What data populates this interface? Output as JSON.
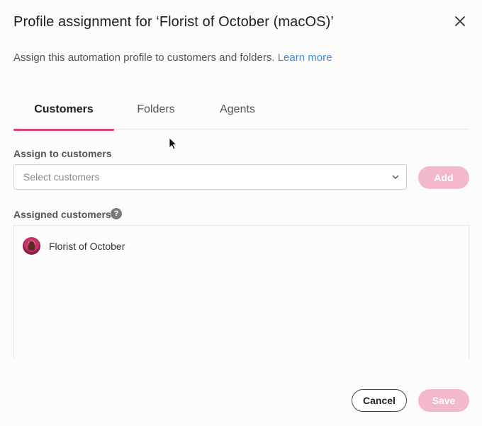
{
  "dialog": {
    "title": "Profile assignment for ‘Florist of October (macOS)’",
    "subtitle": "Assign this automation profile to customers and folders.",
    "learn_more": "Learn more"
  },
  "tabs": [
    {
      "label": "Customers",
      "active": true
    },
    {
      "label": "Folders",
      "active": false
    },
    {
      "label": "Agents",
      "active": false
    }
  ],
  "assign": {
    "label": "Assign to customers",
    "placeholder": "Select customers",
    "add_label": "Add"
  },
  "assigned": {
    "label": "Assigned customers",
    "help_glyph": "?",
    "items": [
      {
        "name": "Florist of October",
        "icon": "customer-avatar"
      }
    ]
  },
  "footer": {
    "cancel_label": "Cancel",
    "save_label": "Save"
  },
  "colors": {
    "accent": "#d9457d",
    "button_disabled": "#f4b8cd",
    "link": "#3b8fd8"
  }
}
